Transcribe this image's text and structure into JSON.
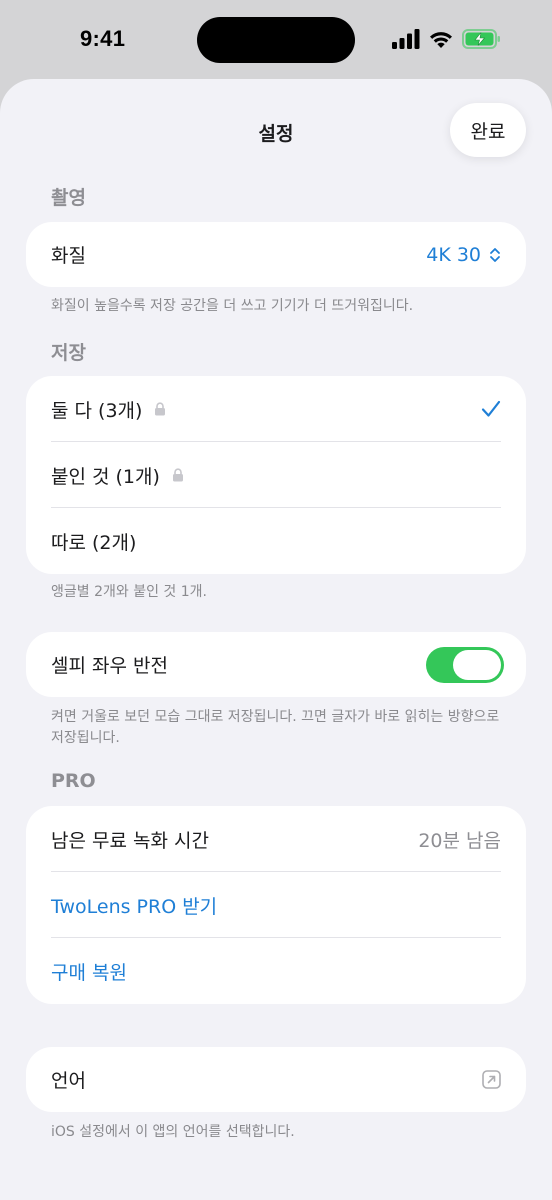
{
  "status_bar": {
    "time": "9:41"
  },
  "header": {
    "title": "설정",
    "done_label": "완료"
  },
  "sections": {
    "capture": {
      "header": "촬영",
      "quality_label": "화질",
      "quality_value": "4K 30",
      "footer": "화질이 높을수록 저장 공간을 더 쓰고 기기가 더 뜨거워집니다."
    },
    "storage": {
      "header": "저장",
      "options": [
        {
          "label": "둘 다 (3개)",
          "locked": true,
          "selected": true
        },
        {
          "label": "붙인 것 (1개)",
          "locked": true,
          "selected": false
        },
        {
          "label": "따로 (2개)",
          "locked": false,
          "selected": false
        }
      ],
      "footer": "앵글별 2개와 붙인 것 1개."
    },
    "selfie": {
      "label": "셀피 좌우 반전",
      "toggle_on": true,
      "footer": "켜면 거울로 보던 모습 그대로 저장됩니다. 끄면 글자가 바로 읽히는 방향으로 저장됩니다."
    },
    "pro": {
      "header": "PRO",
      "free_time_label": "남은 무료 녹화 시간",
      "free_time_value": "20분 남음",
      "get_pro_label": "TwoLens PRO 받기",
      "restore_label": "구매 복원"
    },
    "language": {
      "label": "언어",
      "footer": "iOS 설정에서 이 앱의 언어를 선택합니다."
    }
  },
  "colors": {
    "accent": "#1f7fd6",
    "toggle_on": "#34c759",
    "battery": "#34c759",
    "background": "#f2f2f7"
  },
  "icons": [
    "signal-icon",
    "wifi-icon",
    "battery-charging-icon",
    "chevron-updown-icon",
    "lock-icon",
    "checkmark-icon",
    "external-link-icon"
  ]
}
